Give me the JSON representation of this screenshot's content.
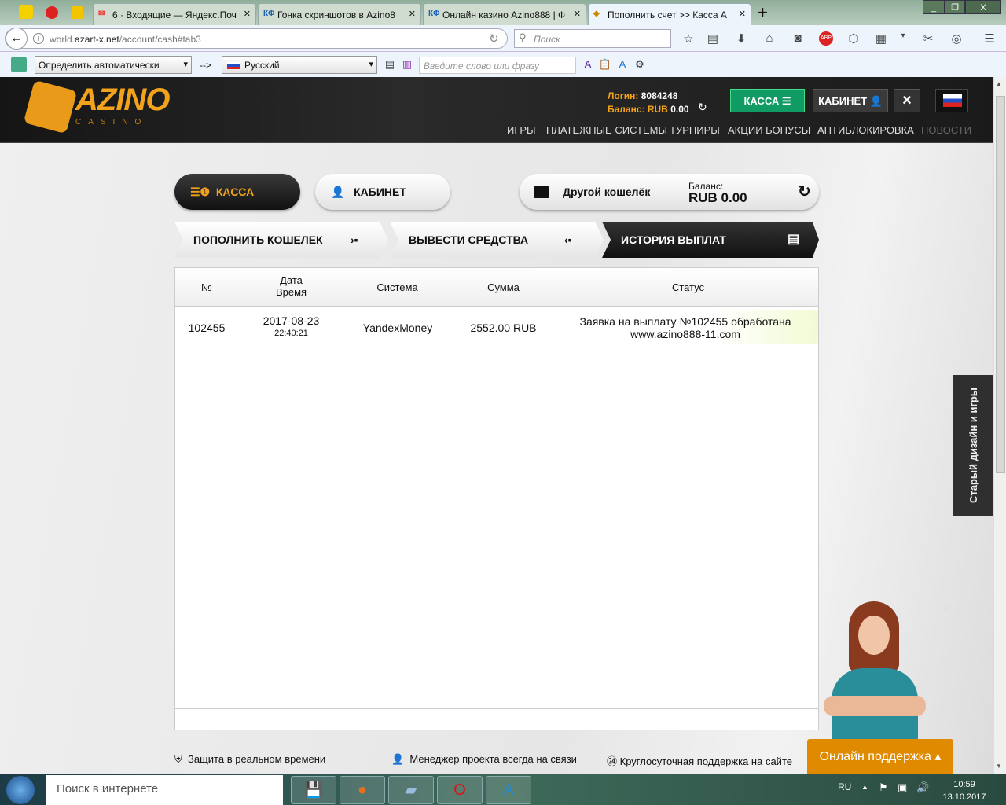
{
  "browser": {
    "tabs": [
      {
        "title": "6 · Входящие — Яндекс.Поч",
        "icon": "mail-icon"
      },
      {
        "title": "Гонка скриншотов в Azino8",
        "icon": "kf-icon"
      },
      {
        "title": "Онлайн казино Azino888 | Ф",
        "icon": "kf-icon"
      },
      {
        "title": "Пополнить счет >> Касса A",
        "icon": "box-icon"
      }
    ],
    "kf": "КФ",
    "url_host_prefix": "world.",
    "url_host": "azart-x.net",
    "url_path": "/account/cash#tab3",
    "search_placeholder": "Поиск",
    "translate_from": "Определить автоматически",
    "translate_arrow": "-->",
    "translate_to": "Русский",
    "translate_placeholder": "Введите слово или фразу"
  },
  "header": {
    "logo": "AZINO",
    "logo_sub": "CASINO",
    "login_label": "Логин:",
    "login_value": "8084248",
    "balance_label": "Баланс: RUB",
    "balance_value": "0.00",
    "kassa": "КАССА",
    "kabinet": "КАБИНЕТ",
    "nav": [
      "ИГРЫ",
      "ПЛАТЕЖНЫЕ СИСТЕМЫ",
      "ТУРНИРЫ",
      "АКЦИИ БОНУСЫ",
      "АНТИБЛОКИРОВКА",
      "НОВОСТИ"
    ]
  },
  "cash": {
    "kassa": "КАССА",
    "kabinet": "КАБИНЕТ",
    "wallet": "Другой кошелёк",
    "balance_label": "Баланс:",
    "balance_value": "RUB 0.00",
    "steps": [
      "ПОПОЛНИТЬ КОШЕЛЕК",
      "ВЫВЕСТИ СРЕДСТВА",
      "ИСТОРИЯ ВЫПЛАТ"
    ],
    "columns": [
      "№",
      "Дата",
      "Время",
      "Система",
      "Сумма",
      "Статус"
    ],
    "rows": [
      {
        "id": "102455",
        "date": "2017-08-23",
        "time": "22:40:21",
        "system": "YandexMoney",
        "amount": "2552.00 RUB",
        "status": "Заявка на выплату №102455 обработана",
        "site": "www.azino888-11.com"
      }
    ]
  },
  "footer": {
    "features": [
      "Защита в реальном времени",
      "Менеджер проекта всегда на связи",
      "Круглосуточная поддержка на сайте"
    ],
    "support": "Онлайн поддержка",
    "old_design": "Старый дизайн и игры"
  },
  "taskbar": {
    "search": "Поиск в интернете",
    "lang": "RU",
    "time": "10:59",
    "date": "13.10.2017"
  }
}
